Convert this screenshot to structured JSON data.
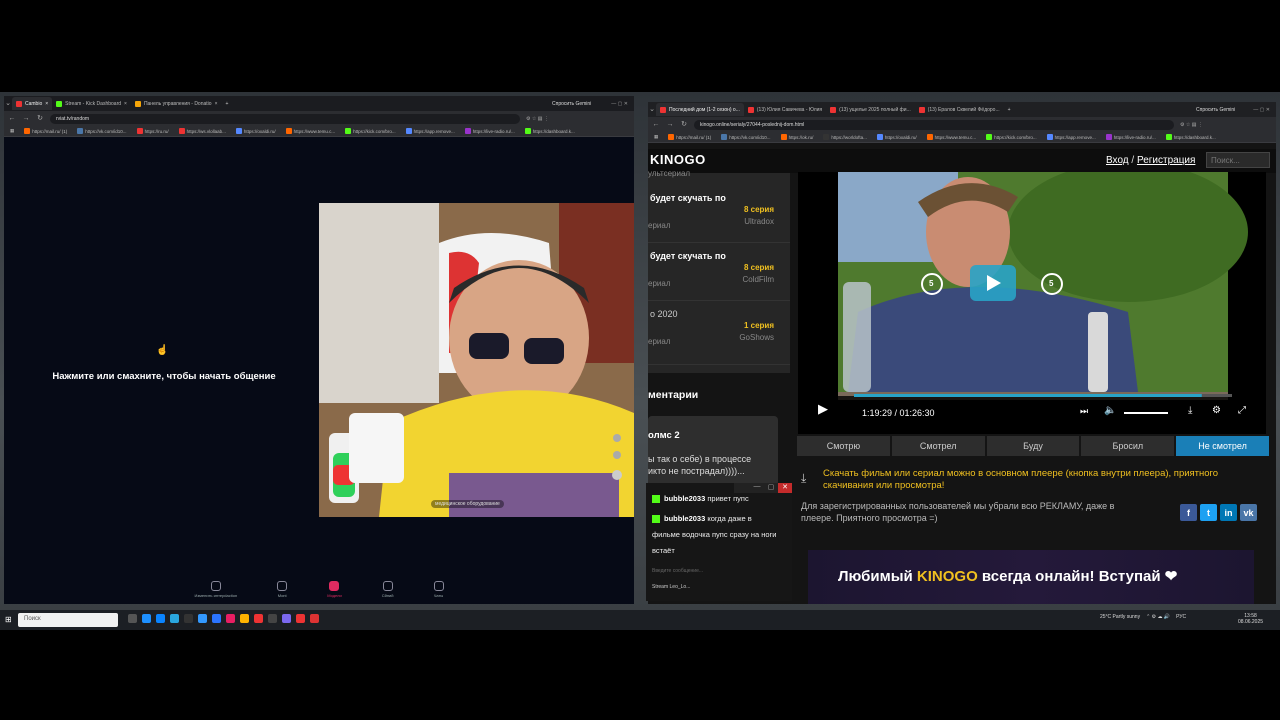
{
  "left_browser": {
    "tabs": [
      {
        "label": "Cambio",
        "color": "#e33"
      },
      {
        "label": "Stream - Kick Dashboard",
        "color": "#53fc18"
      },
      {
        "label": "Панель управления - Donatio",
        "color": "#f6a609"
      }
    ],
    "gemini_label": "Спросить Gemini",
    "url": "rviat.tv/random",
    "bookmarks": [
      "https://mail.ru/ (1)",
      "https://vk.com/id10...",
      "https://ru.ru/",
      "https://ws.vlollaab...",
      "https://oxaldi.ru/",
      "https://www.temu.c...",
      "https://kick.com/bro...",
      "https://app.remove...",
      "https://live-radio.ru/...",
      "https://dashboard.k..."
    ],
    "prompt_text": "Нажмите или смахните, чтобы начать общение",
    "bottom_nav": [
      "Изменить интерdaction",
      "Mont",
      "Модели",
      "Сйний",
      "Чаты"
    ],
    "cam_overlay": "медицинское оборудование"
  },
  "right_browser": {
    "tabs": [
      {
        "label": "Последний дом (1-2 сезон) о...",
        "color": "#e33"
      },
      {
        "label": "(13) Юлия Савичева - Юлия",
        "color": "#e33"
      },
      {
        "label": "(13) ущелье 2025 полный фи...",
        "color": "#e33"
      },
      {
        "label": "(13) Ералов Сквелий Фёдоро...",
        "color": "#e33"
      }
    ],
    "gemini_label": "Спросить Gemini",
    "url": "kinogo.online/serialy/27044-poslednij-dom.html",
    "bookmarks": [
      "https://mail.ru/ (1)",
      "https://vk.com/id10...",
      "https://ok.ru/",
      "https://worldofta...",
      "https://oxaldi.ru/",
      "https://www.temu.c...",
      "https://kick.com/bro...",
      "https://app.remove...",
      "https://live-radio.ru/...",
      "https://dashboard.k..."
    ]
  },
  "site": {
    "logo": "KINOGO",
    "login": "Вход",
    "separator": "/",
    "register": "Регистрация",
    "search_placeholder": "Поиск...",
    "sidebar_top": "ультсериал",
    "sidebar_items": [
      {
        "title": "будет скучать по",
        "sub": "ериал",
        "episode": "8 серия",
        "source": "Ultradox"
      },
      {
        "title": "будет скучать по",
        "sub": "ериал",
        "episode": "8 серия",
        "source": "ColdFilm"
      },
      {
        "title": "о  2020",
        "sub": "ериал",
        "episode": "1 серия",
        "source": "GoShows"
      }
    ],
    "comments_title": "ментарии",
    "comment": {
      "author": "олмс 2",
      "text1": "ы так о себе) в процессе",
      "text2": "икто не пострадал))))..."
    },
    "player": {
      "time": "1:19:29 / 01:26:30",
      "rewind": "5",
      "forward": "5",
      "progress": 0.92
    },
    "status_buttons": [
      "Смотрю",
      "Смотрел",
      "Буду",
      "Бросил",
      "Не смотрел"
    ],
    "download_note": "Скачать фильм или сериал можно в основном плеере (кнопка внутри плеера), приятного скачивания или просмотра!",
    "ad_note": "Для зарегистрированных пользователей мы убрали всю РЕКЛАМУ, даже в плеере. Приятного просмотра =)",
    "social": [
      "f",
      "t",
      "in",
      "vk"
    ],
    "banner_pre": "Любимый ",
    "banner_hl": "KINOGO",
    "banner_post": " всегда онлайн! Вступай ❤"
  },
  "stream_chat": {
    "messages": [
      {
        "user": "bubble2033",
        "text": "привет пупс"
      },
      {
        "user": "bubble2033",
        "text": "когда даже в"
      },
      {
        "user": "",
        "text": "фильме водочка пупс сразу на ноги"
      },
      {
        "user": "",
        "text": "встаёт"
      }
    ],
    "input_placeholder": "Введите сообщение...",
    "footer": "Stream Leo_Lo..."
  },
  "taskbar": {
    "search": "Поиск",
    "weather": "25°C  Partly sunny",
    "lang": "РУС",
    "time": "13:58",
    "date": "08.06.2025"
  }
}
